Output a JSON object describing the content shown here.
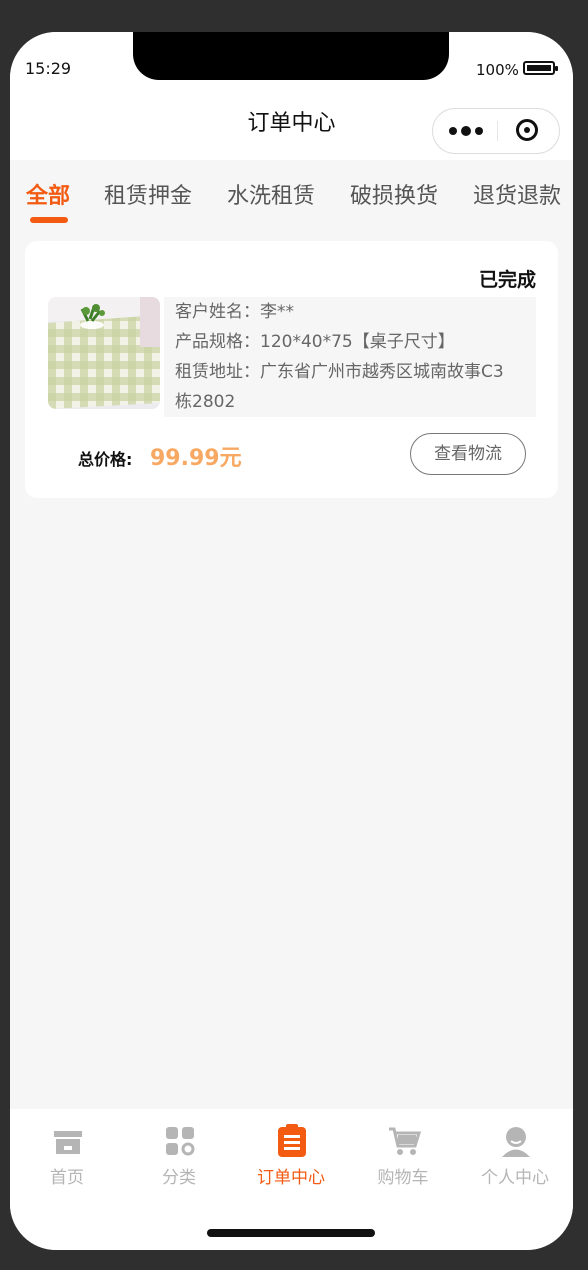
{
  "status_bar": {
    "time": "15:29",
    "battery": "100%"
  },
  "navbar": {
    "title": "订单中心",
    "more_icon": "more-dots-icon",
    "target_icon": "target-icon"
  },
  "tabs": {
    "items": [
      {
        "label": "全部",
        "active": true
      },
      {
        "label": "租赁押金",
        "active": false
      },
      {
        "label": "水洗租赁",
        "active": false
      },
      {
        "label": "破损换货",
        "active": false
      },
      {
        "label": "退货退款",
        "active": false
      }
    ]
  },
  "order": {
    "status": "已完成",
    "customer_label": "客户姓名：",
    "customer_value": "李**",
    "spec_label": "产品规格：",
    "spec_value": "120*40*75【桌子尺寸】",
    "address_label": "租赁地址：",
    "address_value_line1": "广东省广州市越秀区城南故事C3",
    "address_value_line2": "栋2802",
    "price_label": "总价格:",
    "price_value": "99.99元",
    "logistics_button": "查看物流"
  },
  "tabbar": {
    "items": [
      {
        "label": "首页",
        "icon": "shop-icon",
        "active": false
      },
      {
        "label": "分类",
        "icon": "category-icon",
        "active": false
      },
      {
        "label": "订单中心",
        "icon": "clipboard-icon",
        "active": true
      },
      {
        "label": "购物车",
        "icon": "cart-icon",
        "active": false
      },
      {
        "label": "个人中心",
        "icon": "user-icon",
        "active": false
      }
    ]
  },
  "colors": {
    "accent": "#f35b12",
    "price": "#f7a964",
    "inactive": "#b5b5b5"
  }
}
